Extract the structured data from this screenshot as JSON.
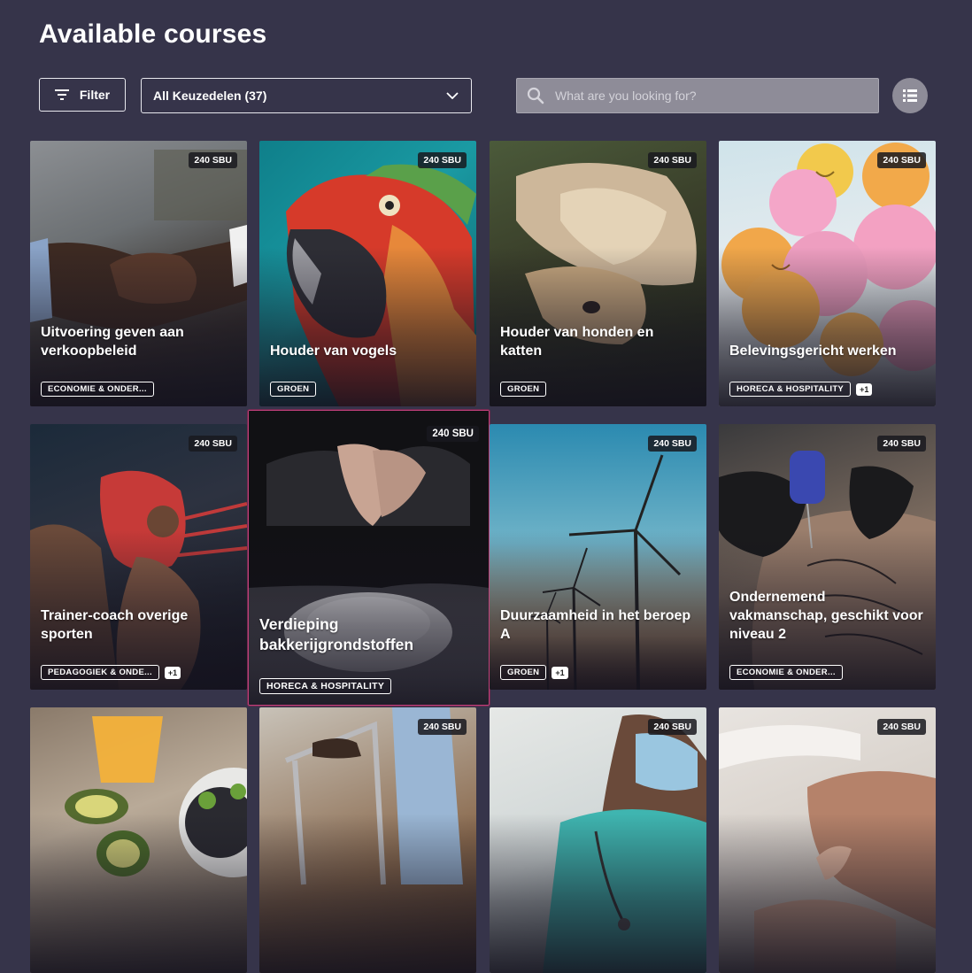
{
  "header": {
    "title": "Available courses"
  },
  "toolbar": {
    "filter_label": "Filter",
    "select_value": "All Keuzedelen (37)",
    "search_placeholder": "What are you looking for?"
  },
  "courses": [
    {
      "sbu": "240 SBU",
      "title": "Uitvoering geven aan verkoopbeleid",
      "tag": "ECONOMIE & ONDER...",
      "extra": ""
    },
    {
      "sbu": "240 SBU",
      "title": "Houder van vogels",
      "tag": "GROEN",
      "extra": ""
    },
    {
      "sbu": "240 SBU",
      "title": "Houder van honden en katten",
      "tag": "GROEN",
      "extra": ""
    },
    {
      "sbu": "240 SBU",
      "title": "Belevingsgericht werken",
      "tag": "HORECA & HOSPITALITY",
      "extra": "+1"
    },
    {
      "sbu": "240 SBU",
      "title": "Trainer-coach overige sporten",
      "tag": "PEDAGOGIEK & ONDE...",
      "extra": "+1"
    },
    {
      "sbu": "240 SBU",
      "title": "Verdieping bakkerijgrondstoffen",
      "tag": "HORECA & HOSPITALITY",
      "extra": ""
    },
    {
      "sbu": "240 SBU",
      "title": "Duurzaamheid in het beroep A",
      "tag": "GROEN",
      "extra": "+1"
    },
    {
      "sbu": "240 SBU",
      "title": "Ondernemend vakmanschap, geschikt voor niveau 2",
      "tag": "ECONOMIE & ONDER...",
      "extra": ""
    },
    {
      "sbu": "",
      "title": "",
      "tag": "",
      "extra": ""
    },
    {
      "sbu": "240 SBU",
      "title": "",
      "tag": "",
      "extra": ""
    },
    {
      "sbu": "240 SBU",
      "title": "",
      "tag": "",
      "extra": ""
    },
    {
      "sbu": "240 SBU",
      "title": "",
      "tag": "",
      "extra": ""
    }
  ]
}
